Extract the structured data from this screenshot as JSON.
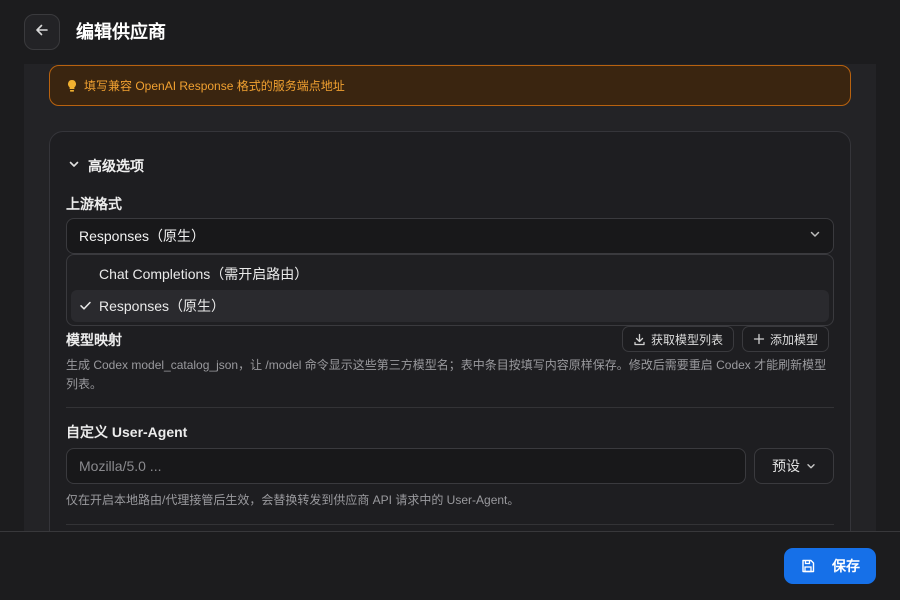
{
  "header": {
    "title": "编辑供应商",
    "back_icon": "arrow-left-icon"
  },
  "hint": {
    "text": "填写兼容 OpenAI Response 格式的服务端点地址",
    "icon": "lightbulb-icon",
    "color": "#f0a030"
  },
  "advanced": {
    "toggle_label": "高级选项",
    "upstream_format": {
      "label": "上游格式",
      "selected": "Responses（原生）",
      "options": [
        {
          "label": "Chat Completions（需开启路由）",
          "selected": false
        },
        {
          "label": "Responses（原生）",
          "selected": true
        }
      ]
    },
    "model_mapping": {
      "label": "模型映射",
      "fetch_button": "获取模型列表",
      "add_button": "添加模型",
      "description": "生成 Codex model_catalog_json，让 /model 命令显示这些第三方模型名；表中条目按填写内容原样保存。修改后需要重启 Codex 才能刷新模型列表。"
    },
    "user_agent": {
      "label": "自定义 User-Agent",
      "placeholder": "Mozilla/5.0 ...",
      "preset_button": "预设",
      "description": "仅在开启本地路由/代理接管后生效，会替换转发到供应商 API 请求中的 User-Agent。"
    }
  },
  "footer": {
    "save_label": "保存",
    "accent": "#1670e8"
  }
}
